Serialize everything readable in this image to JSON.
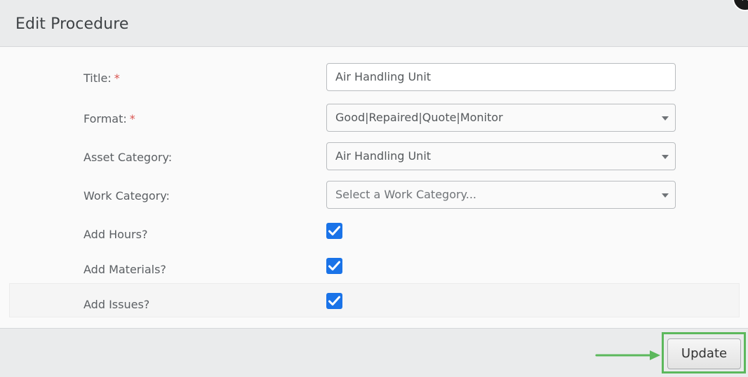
{
  "dialog": {
    "title": "Edit Procedure",
    "close_glyph": "✕"
  },
  "form": {
    "title_label": "Title:",
    "title_value": "Air Handling Unit",
    "format_label": "Format:",
    "format_value": "Good|Repaired|Quote|Monitor",
    "asset_category_label": "Asset Category:",
    "asset_category_value": "Air Handling Unit",
    "work_category_label": "Work Category:",
    "work_category_placeholder": "Select a Work Category...",
    "add_hours_label": "Add Hours?",
    "add_hours_checked": true,
    "add_materials_label": "Add Materials?",
    "add_materials_checked": true,
    "add_issues_label": "Add Issues?",
    "add_issues_checked": true,
    "required_marker": "*"
  },
  "footer": {
    "update_label": "Update"
  },
  "colors": {
    "accent": "#1a73e8",
    "highlight": "#5cb85c",
    "required": "#d9534f"
  },
  "icons": {
    "checkbox": "check-icon",
    "dropdown": "caret-down-icon",
    "close": "close-icon",
    "annotation": "arrow-right-icon"
  }
}
